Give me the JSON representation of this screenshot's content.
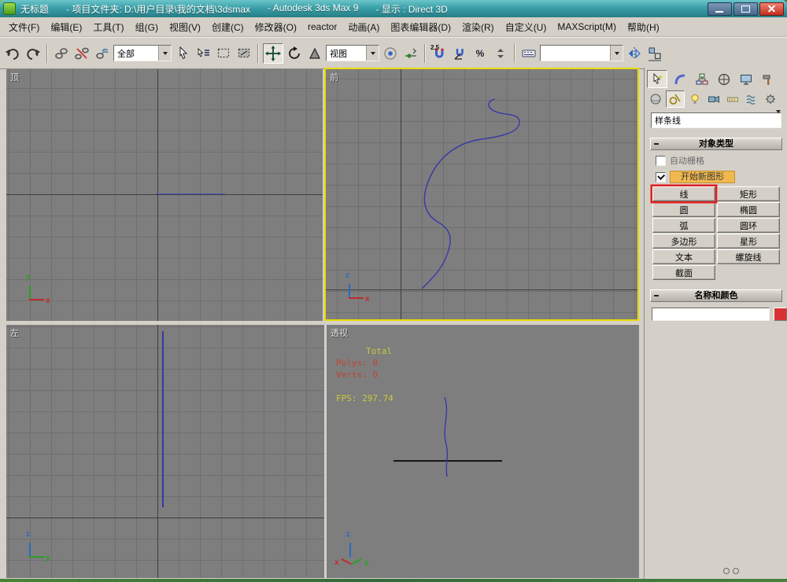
{
  "colors": {
    "accent-yellow": "#e8dc00",
    "highlight-orange": "#f0b84e",
    "annotation-red": "#e02020",
    "swatch-red": "#d83232"
  },
  "window": {
    "title_untitled": "无标题",
    "title_project": "- 项目文件夹: D:\\用户目录\\我的文档\\3dsmax",
    "title_app": "- Autodesk 3ds Max 9",
    "title_display": "- 显示 : Direct 3D"
  },
  "menu": {
    "items": [
      "文件(F)",
      "编辑(E)",
      "工具(T)",
      "组(G)",
      "视图(V)",
      "创建(C)",
      "修改器(O)",
      "reactor",
      "动画(A)",
      "图表编辑器(D)",
      "渲染(R)",
      "自定义(U)",
      "MAXScript(M)",
      "帮助(H)"
    ]
  },
  "toolbar": {
    "selection_filter": "全部",
    "coord_system": "视图",
    "snap_label": "2.5",
    "percent_label": "%",
    "named_selection_value": ""
  },
  "viewports": {
    "top": {
      "label": "顶",
      "axis_v": "y",
      "axis_h": "x"
    },
    "front": {
      "label": "前",
      "axis_v": "z",
      "axis_h": "x"
    },
    "left": {
      "label": "左",
      "axis_v": "z",
      "axis_h": "y"
    },
    "perspective": {
      "label": "透视",
      "axis_v": "z",
      "axis_l": "x",
      "axis_r": "y",
      "stats": {
        "total": "Total",
        "polys": "Polys: 0",
        "verts": "Verts: 0",
        "fps": "FPS: 297.74"
      }
    }
  },
  "command_panel": {
    "category_dropdown": "样条线",
    "object_type": {
      "title": "对象类型",
      "autogrid_label": "自动栅格",
      "start_new_shape_label": "开始新图形",
      "buttons": [
        "线",
        "矩形",
        "圆",
        "椭圆",
        "弧",
        "圆环",
        "多边形",
        "星形",
        "文本",
        "螺旋线",
        "截面"
      ]
    },
    "name_color": {
      "title": "名称和颜色",
      "name_value": ""
    }
  }
}
